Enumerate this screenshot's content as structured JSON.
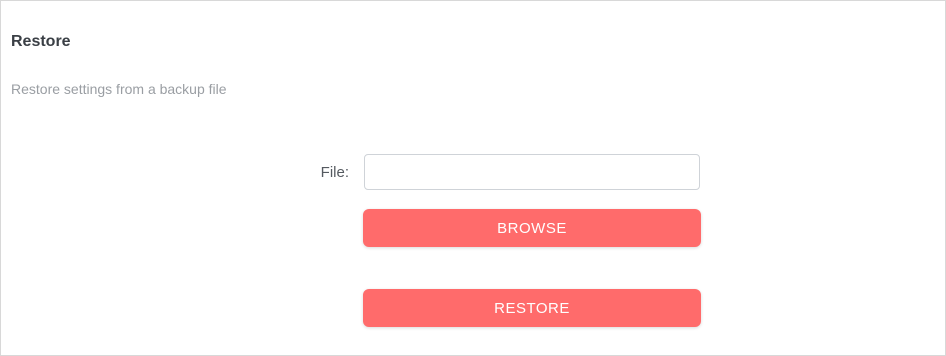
{
  "section": {
    "title": "Restore",
    "description": "Restore settings from a backup file"
  },
  "form": {
    "file_label": "File:",
    "file_value": "",
    "browse_label": "BROWSE",
    "restore_label": "RESTORE"
  },
  "colors": {
    "accent": "#ff6b6b",
    "title_text": "#3a3f45",
    "muted_text": "#9a9ea3",
    "border": "#d8d8d8"
  }
}
